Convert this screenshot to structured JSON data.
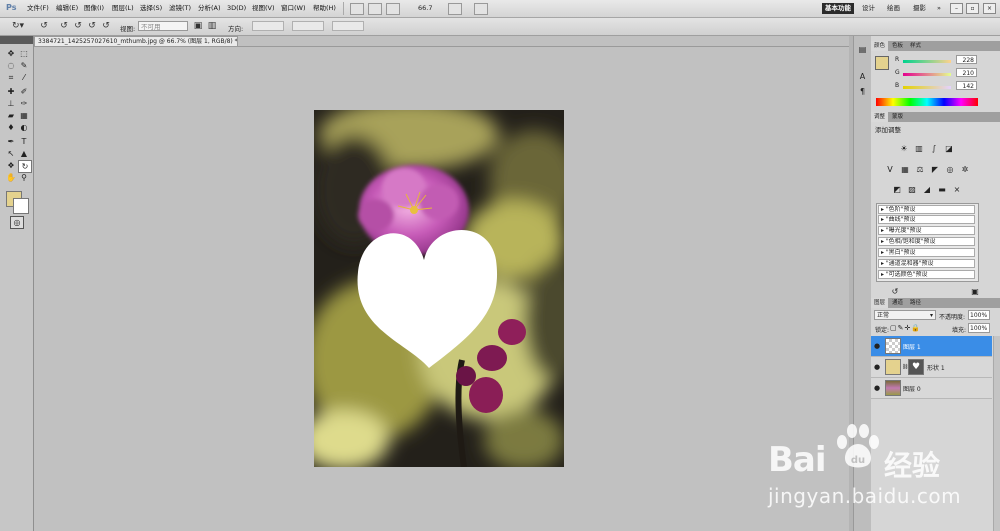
{
  "menubar": {
    "logo": "Ps",
    "items": [
      "文件(F)",
      "编辑(E)",
      "图像(I)",
      "图层(L)",
      "选择(S)",
      "滤镜(T)",
      "分析(A)",
      "3D(D)",
      "视图(V)",
      "窗口(W)",
      "帮助(H)"
    ],
    "zoom": "66.7",
    "workspaces": [
      "基本功能",
      "设计",
      "绘画",
      "摄影"
    ],
    "more": "»"
  },
  "options": {
    "view_label": "视图:",
    "view_value": "不可用",
    "direction_label": "方向:"
  },
  "document": {
    "tab_title": "3384721_1425257027610_mthumb.jpg @ 66.7% (图层 1, RGB/8) *",
    "close": "×"
  },
  "color_panel": {
    "tabs": [
      "颜色",
      "色板",
      "样式"
    ],
    "channels": [
      {
        "label": "R",
        "value": "228"
      },
      {
        "label": "G",
        "value": "210"
      },
      {
        "label": "B",
        "value": "142"
      }
    ],
    "foreground": "#e4d28e"
  },
  "adjust_panel": {
    "tabs": [
      "调整",
      "蒙版"
    ],
    "title": "添加调整",
    "presets": [
      "\"色阶\"预设",
      "\"曲线\"预设",
      "\"曝光度\"预设",
      "\"色相/饱和度\"预设",
      "\"黑白\"预设",
      "\"通道混和器\"预设",
      "\"可选颜色\"预设"
    ]
  },
  "layers_panel": {
    "tabs": [
      "图层",
      "通道",
      "路径"
    ],
    "blend_mode": "正常",
    "opacity_label": "不透明度:",
    "opacity": "100%",
    "lock_label": "锁定:",
    "fill_label": "填充:",
    "fill": "100%",
    "layers": [
      {
        "name": "图层 1",
        "selected": true
      },
      {
        "name": "形状 1",
        "selected": false
      },
      {
        "name": "图层 0",
        "selected": false
      }
    ]
  },
  "watermark": {
    "brand_latin": "Bai",
    "brand_cn": "经验",
    "url": "jingyan.baidu.com"
  }
}
